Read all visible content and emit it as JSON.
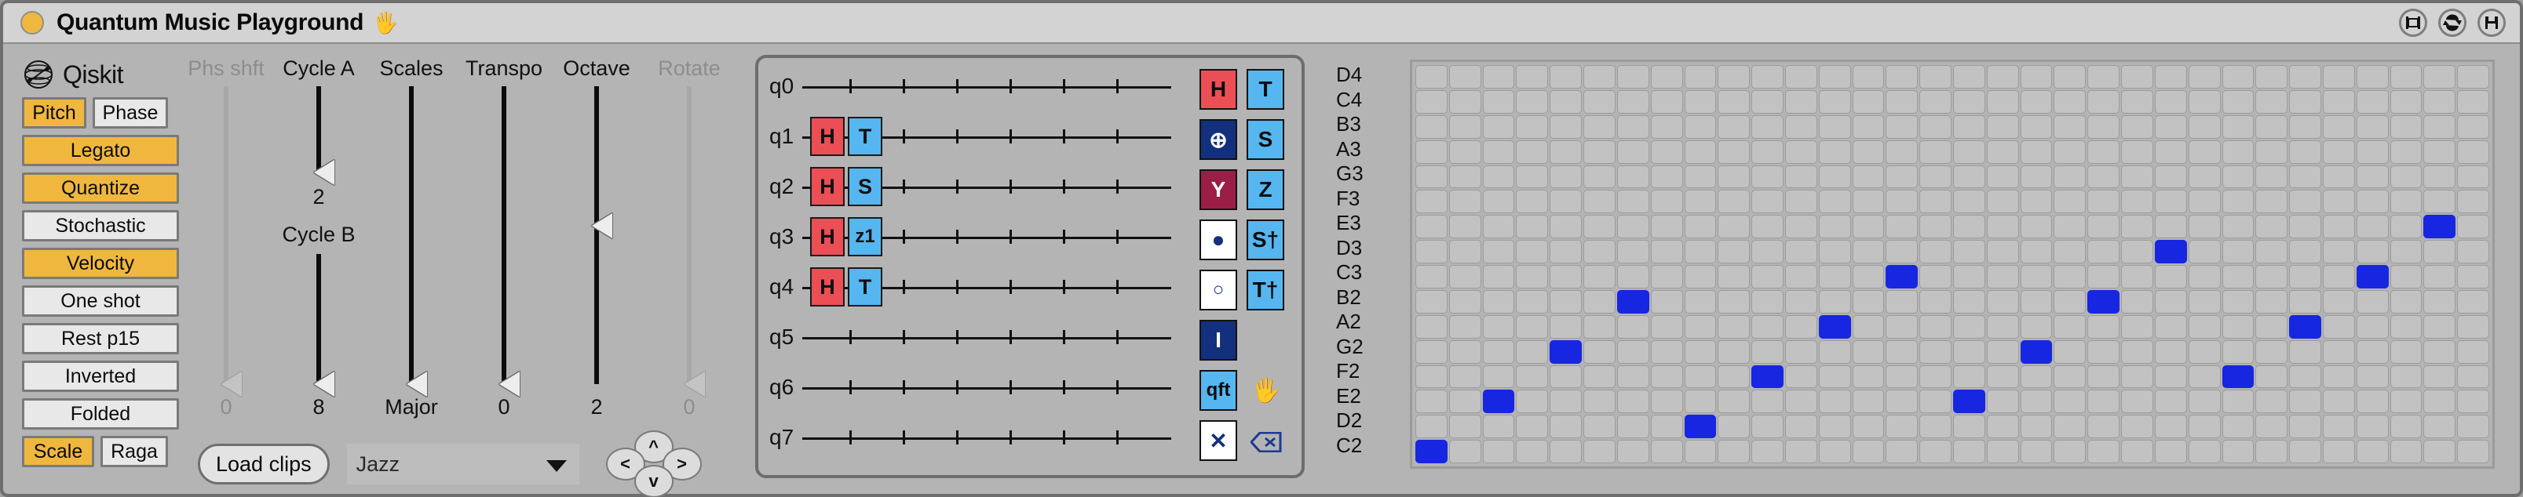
{
  "window": {
    "title": "Quantum Music Playground",
    "hand_icon": "hand-icon",
    "controls": [
      {
        "name": "fit-window-icon",
        "label": "fit"
      },
      {
        "name": "refresh-icon",
        "label": "refresh"
      },
      {
        "name": "save-icon",
        "label": "save"
      }
    ]
  },
  "left_panel": {
    "brand": "Qiskit",
    "toggle_pair": [
      {
        "label": "Pitch",
        "active": true
      },
      {
        "label": "Phase",
        "active": false
      }
    ],
    "buttons": [
      {
        "label": "Legato",
        "active": true
      },
      {
        "label": "Quantize",
        "active": true
      },
      {
        "label": "Stochastic",
        "active": false
      },
      {
        "label": "Velocity",
        "active": true
      },
      {
        "label": "One shot",
        "active": false
      },
      {
        "label": "Rest p15",
        "active": false
      },
      {
        "label": "Inverted",
        "active": false
      },
      {
        "label": "Folded",
        "active": false
      }
    ],
    "mode_pair": [
      {
        "label": "Scale",
        "active": true
      },
      {
        "label": "Raga",
        "active": false
      }
    ]
  },
  "sliders": [
    {
      "label": "Phs shft",
      "value": "0",
      "disabled": true,
      "thumb_pct": 100,
      "track_pct": 0
    },
    {
      "label": "Cycle A",
      "value": "2",
      "disabled": false,
      "thumb_pct": 30,
      "track_pct": 30,
      "sub_label": "Cycle B",
      "sub_value": "8",
      "sub_thumb_pct": 100
    },
    {
      "label": "Scales",
      "value": "Major",
      "disabled": false,
      "thumb_pct": 100,
      "track_pct": 100
    },
    {
      "label": "Transpo",
      "value": "0",
      "disabled": false,
      "thumb_pct": 100,
      "track_pct": 100
    },
    {
      "label": "Octave",
      "value": "2",
      "disabled": false,
      "thumb_pct": 42,
      "track_pct": 100
    },
    {
      "label": "Rotate",
      "value": "0",
      "disabled": true,
      "thumb_pct": 100,
      "track_pct": 0
    }
  ],
  "bottom_bar": {
    "load_clips_label": "Load clips",
    "genre_value": "Jazz",
    "dpad": [
      {
        "name": "nav-up-button",
        "label": "^"
      },
      {
        "name": "nav-left-button",
        "label": "<"
      },
      {
        "name": "nav-right-button",
        "label": ">"
      },
      {
        "name": "nav-down-button",
        "label": "v"
      }
    ]
  },
  "circuit": {
    "qubits": [
      {
        "label": "q0",
        "gates": []
      },
      {
        "label": "q1",
        "gates": [
          {
            "symbol": "H",
            "kind": "h"
          },
          {
            "symbol": "T",
            "kind": "blue"
          }
        ]
      },
      {
        "label": "q2",
        "gates": [
          {
            "symbol": "H",
            "kind": "h"
          },
          {
            "symbol": "S",
            "kind": "blue"
          }
        ]
      },
      {
        "label": "q3",
        "gates": [
          {
            "symbol": "H",
            "kind": "h"
          },
          {
            "symbol": "z1",
            "kind": "blue"
          }
        ]
      },
      {
        "label": "q4",
        "gates": [
          {
            "symbol": "H",
            "kind": "h"
          },
          {
            "symbol": "T",
            "kind": "blue"
          }
        ]
      },
      {
        "label": "q5",
        "gates": []
      },
      {
        "label": "q6",
        "gates": []
      },
      {
        "label": "q7",
        "gates": []
      }
    ],
    "palette_left": [
      {
        "symbol": "H",
        "style": "p-red",
        "name": "gate-h"
      },
      {
        "symbol": "⊕",
        "style": "p-navy",
        "name": "gate-cnot"
      },
      {
        "symbol": "Y",
        "style": "p-maroon",
        "name": "gate-y"
      },
      {
        "symbol": "●",
        "style": "p-white",
        "name": "gate-control"
      },
      {
        "symbol": "○",
        "style": "p-white",
        "name": "gate-anticontrol"
      },
      {
        "symbol": "I",
        "style": "p-navy",
        "name": "gate-identity"
      },
      {
        "symbol": "qft",
        "style": "p-blue",
        "name": "gate-qft"
      },
      {
        "symbol": "✕",
        "style": "p-white",
        "name": "gate-swap"
      }
    ],
    "palette_right": [
      {
        "symbol": "T",
        "style": "p-blue",
        "name": "gate-t"
      },
      {
        "symbol": "S",
        "style": "p-blue",
        "name": "gate-s"
      },
      {
        "symbol": "Z",
        "style": "p-blue",
        "name": "gate-z"
      },
      {
        "symbol": "S†",
        "style": "p-blue",
        "name": "gate-s-dagger"
      },
      {
        "symbol": "T†",
        "style": "p-blue",
        "name": "gate-t-dagger"
      }
    ],
    "tool_icons": [
      {
        "name": "hand-tool-icon",
        "label": "hand"
      },
      {
        "name": "erase-icon",
        "label": "erase"
      }
    ]
  },
  "piano_roll": {
    "note_labels": [
      "D4",
      "C4",
      "B3",
      "A3",
      "G3",
      "F3",
      "E3",
      "D3",
      "C3",
      "B2",
      "A2",
      "G2",
      "F2",
      "E2",
      "D2",
      "C2"
    ],
    "columns": 32,
    "note_color": "#1726e0",
    "notes": [
      {
        "row": 6,
        "col": 30
      },
      {
        "row": 7,
        "col": 22
      },
      {
        "row": 8,
        "col": 14
      },
      {
        "row": 8,
        "col": 28
      },
      {
        "row": 9,
        "col": 6
      },
      {
        "row": 9,
        "col": 20
      },
      {
        "row": 10,
        "col": 12
      },
      {
        "row": 10,
        "col": 26
      },
      {
        "row": 11,
        "col": 4
      },
      {
        "row": 11,
        "col": 18
      },
      {
        "row": 12,
        "col": 10
      },
      {
        "row": 12,
        "col": 24
      },
      {
        "row": 13,
        "col": 2
      },
      {
        "row": 13,
        "col": 16
      },
      {
        "row": 14,
        "col": 8
      },
      {
        "row": 15,
        "col": 0
      }
    ]
  }
}
